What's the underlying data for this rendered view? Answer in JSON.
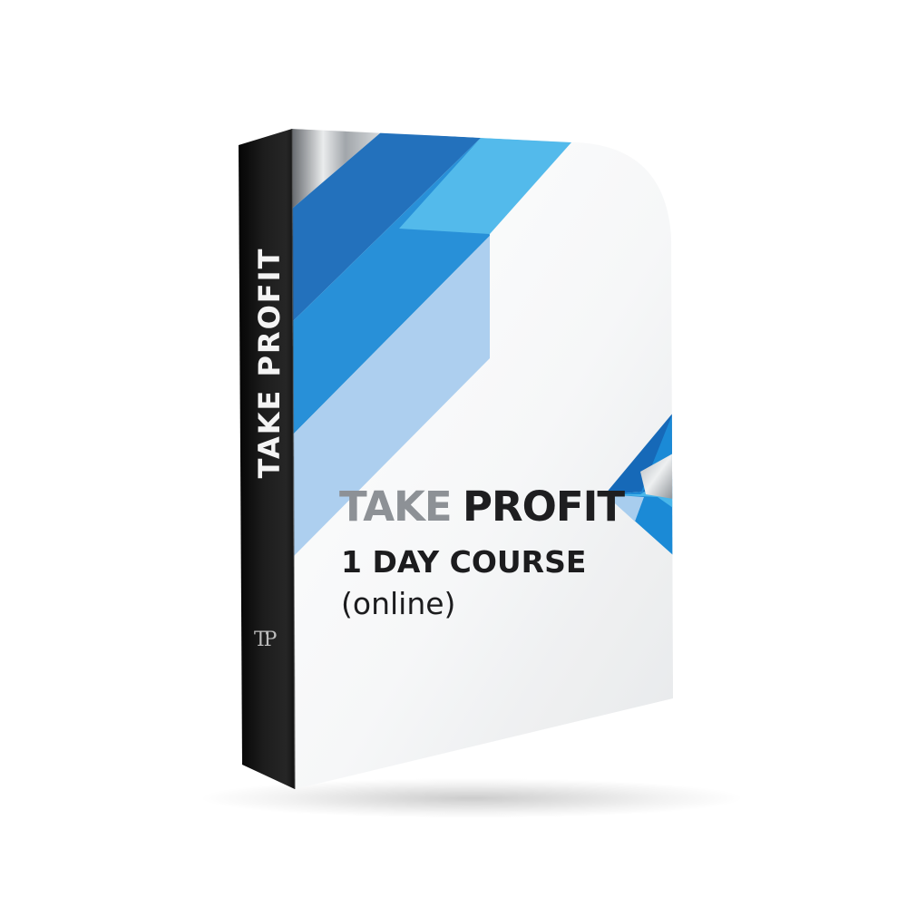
{
  "product": {
    "spine_title": "TAKE PROFIT",
    "spine_logo": "TP",
    "cover_title_part1": "TAKE",
    "cover_title_part2": "PROFIT",
    "cover_subtitle": "1 DAY COURSE",
    "cover_subtitle_note": "(online)"
  },
  "colors": {
    "background": "#ffffff",
    "spine": "#141414",
    "cover_white": "#f7f7f7",
    "blue_dark": "#1669b8",
    "blue_mid": "#1b8ad6",
    "blue_light": "#49b6ea",
    "blue_pale": "#a8cdee",
    "silver": "#c9cdd1",
    "title_grey": "#8d9196",
    "title_dark": "#1e1e20"
  },
  "icons": {
    "cover_arrow": "left-arrow-chevron-icon"
  }
}
